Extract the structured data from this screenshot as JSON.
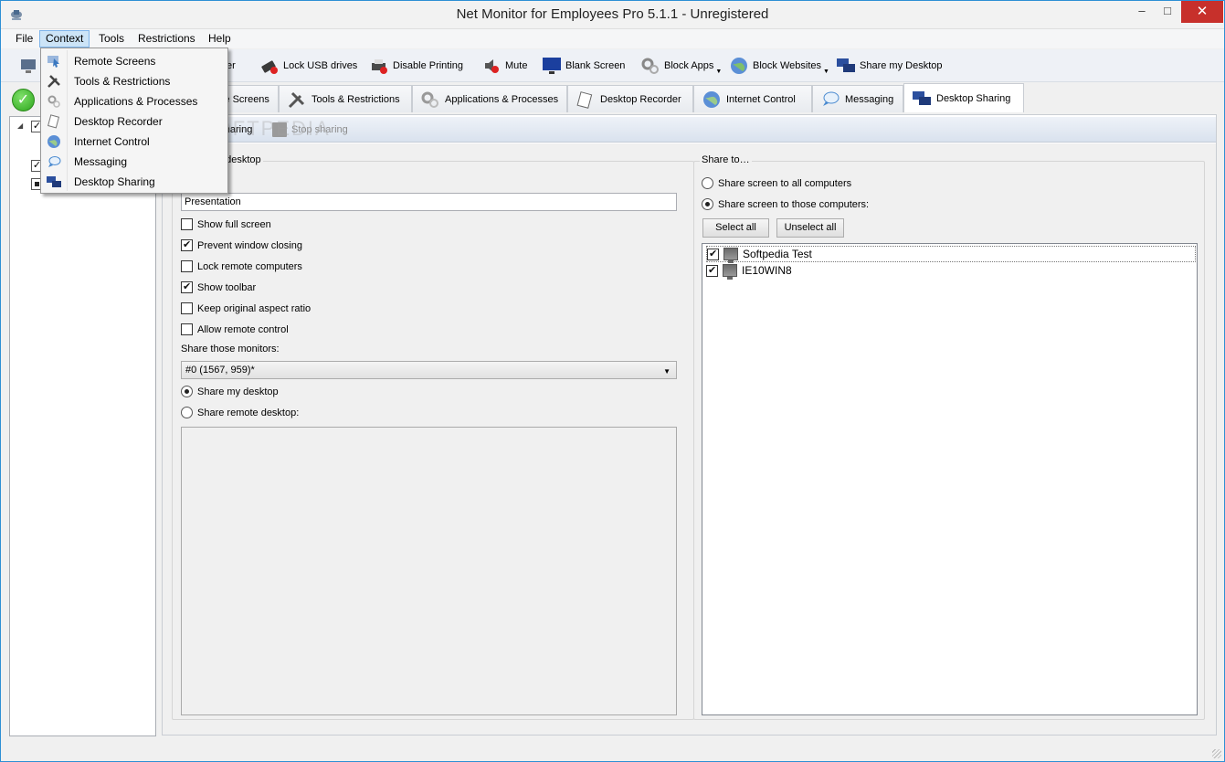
{
  "window": {
    "title": "Net Monitor for Employees Pro 5.1.1 - Unregistered",
    "minimize": "–",
    "maximize": "□",
    "close": "✕"
  },
  "menu": {
    "file": "File",
    "context": "Context",
    "tools": "Tools",
    "restrictions": "Restrictions",
    "help": "Help"
  },
  "context_menu": [
    {
      "label": "Remote Screens",
      "icon": "remote-screens-icon"
    },
    {
      "label": "Tools & Restrictions",
      "icon": "tools-icon"
    },
    {
      "label": "Applications & Processes",
      "icon": "gears-icon"
    },
    {
      "label": "Desktop Recorder",
      "icon": "recorder-icon"
    },
    {
      "label": "Internet Control",
      "icon": "globe-icon"
    },
    {
      "label": "Messaging",
      "icon": "chat-icon"
    },
    {
      "label": "Desktop Sharing",
      "icon": "desktop-sharing-icon"
    }
  ],
  "toolbar": {
    "partial_label": "ter",
    "lock_usb": "Lock USB drives",
    "disable_printing": "Disable Printing",
    "mute": "Mute",
    "blank_screen": "Blank Screen",
    "block_apps": "Block Apps",
    "block_websites": "Block Websites",
    "share_desktop": "Share my Desktop"
  },
  "tabs": {
    "remote_screens": "Remote Screens",
    "tools": "Tools & Restrictions",
    "apps": "Applications & Processes",
    "recorder": "Desktop Recorder",
    "internet": "Internet Control",
    "messaging": "Messaging",
    "sharing": "Desktop Sharing"
  },
  "actions": {
    "start_sharing": "Start sharing",
    "stop_sharing": "Stop sharing"
  },
  "watermark": "SOFTPEDIA",
  "left_group": {
    "title": "Share my desktop",
    "title_input": "Presentation",
    "options": [
      {
        "label": "Show full screen",
        "checked": false
      },
      {
        "label": "Prevent window closing",
        "checked": true
      },
      {
        "label": "Lock remote computers",
        "checked": false
      },
      {
        "label": "Show toolbar",
        "checked": true
      },
      {
        "label": "Keep original aspect ratio",
        "checked": false
      },
      {
        "label": "Allow remote control",
        "checked": false
      }
    ],
    "monitors_label": "Share those monitors:",
    "monitor_selected": "#0 (1567, 959)*",
    "radio_my_desktop": "Share my desktop",
    "radio_remote_desktop": "Share remote desktop:"
  },
  "right_group": {
    "title": "Share to…",
    "radio_all": "Share screen to all computers",
    "radio_those": "Share screen to those computers:",
    "select_all": "Select all",
    "unselect_all": "Unselect all",
    "computers": [
      {
        "name": "Softpedia Test",
        "checked": true
      },
      {
        "name": "IE10WIN8",
        "checked": true
      }
    ]
  }
}
